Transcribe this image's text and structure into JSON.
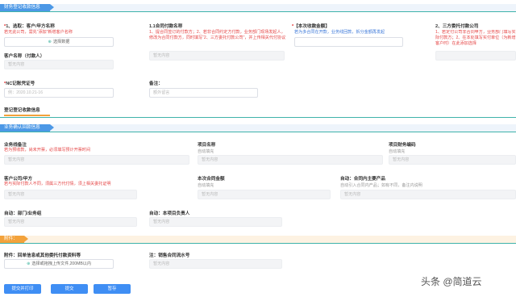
{
  "sections": {
    "finance": "财务登记收款信息",
    "business": "业务确认回款信息",
    "attach": "附件："
  },
  "finance": {
    "customer_label": "1、选取：客户/甲方名称",
    "customer_hint": "若无此公司，需先“添加”新增客户名称",
    "customer_button": "选择数据",
    "payer_label": "客户名称（付款人）",
    "payer_placeholder": "暂无内容",
    "contract_label": "1.1合同付款名称",
    "contract_hint": "1、提合同签订的付款方；2、若非合同约定方付款，业务部门现场发起人，修改为合同付款方，同时填写“2、三方委托付款公司”，并上传相关代付协议",
    "contract_placeholder": "暂无内容",
    "amount_label": "【本次收款金额】",
    "amount_hint": "若为多合同在开款，业务线回款，拆分金额再发起",
    "third_label": "2、三方委托付款公司",
    "third_hint": "1、若定付公司非合同甲方，业务部门填写实际甲方；2、在本处填写实付单位（为新增加客户时）在此添加选择",
    "third_hint_short": "1、若定付公司非合同甲方，业务部门填写实际付款方；2、在本处填写实付单位（为新增客户时）在此添加选择",
    "nc_label": "NC记账凭证号",
    "nc_placeholder": "例：2020.10.21-16",
    "remark_label": "备注：",
    "remark_placeholder": "额外留言",
    "tab_label": "登记登记收款信息"
  },
  "business": {
    "row1": [
      {
        "label": "业务线备注",
        "hint": "若为预收款，尚未开票，必须填写预计开票时间",
        "placeholder": "暂无内容"
      },
      {
        "label": "项目名称",
        "sub": "自动填充",
        "placeholder": "暂无内容"
      },
      {
        "label": "项目财务编码",
        "sub": "自动填充",
        "placeholder": "暂无内容"
      }
    ],
    "row2": [
      {
        "label": "客户公司/甲方",
        "hint": "若与实际付款人不同，须属三方代付情，须上相关委托证明",
        "placeholder": "暂无内容"
      },
      {
        "label": "本次合同金额",
        "sub": "自动填充",
        "placeholder": "暂无内容"
      },
      {
        "label": "自动：合同内主要产品",
        "sub": "自动引入合同内产品；如有不同，备注内说明",
        "placeholder": "暂无内容"
      }
    ],
    "row3": [
      {
        "label": "自动：部门/业务组",
        "placeholder": "暂无内容"
      },
      {
        "label": "自动：本项目负责人",
        "placeholder": "暂无内容"
      }
    ]
  },
  "attach": {
    "upload_label": "附件：回单信息或其他委托付款资料等",
    "upload_button": "选择或拖拽上传文件,200MB以内",
    "sales_label": "注：销售合同流水号",
    "sales_placeholder": "暂无内容"
  },
  "actions": {
    "submit_print": "提交并打印",
    "submit": "提交",
    "save": "暂存"
  },
  "watermark": "头条 @简道云"
}
